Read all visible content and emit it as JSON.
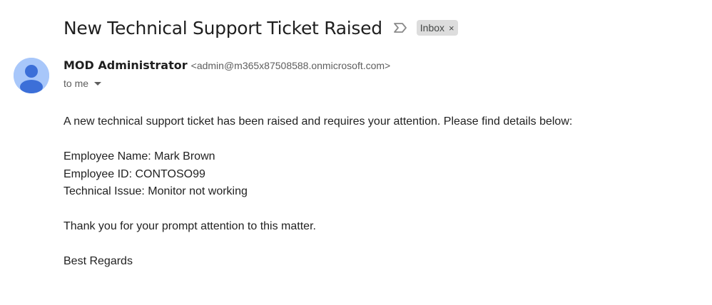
{
  "email": {
    "subject": "New Technical Support Ticket Raised",
    "label": "Inbox",
    "label_remove_glyph": "×",
    "importance_icon": "importance-marker-icon",
    "sender": {
      "name": "MOD Administrator",
      "email": "<admin@m365x87508588.onmicrosoft.com>",
      "avatar_icon": "person-avatar-icon"
    },
    "recipient_text": "to me",
    "body": {
      "intro": "A new technical support ticket has been raised and requires your attention. Please find details below:",
      "employee_name": "Employee Name: Mark Brown",
      "employee_id": "Employee ID: CONTOSO99",
      "technical_issue": "Technical Issue: Monitor not working",
      "thanks": "Thank you for your prompt attention to this matter.",
      "signoff": "Best Regards"
    }
  },
  "colors": {
    "avatar_bg": "#a8c7fa",
    "avatar_fg": "#3c6fd8",
    "chip_bg": "#dddddd",
    "text": "#222222",
    "muted": "#5e5e5e"
  }
}
